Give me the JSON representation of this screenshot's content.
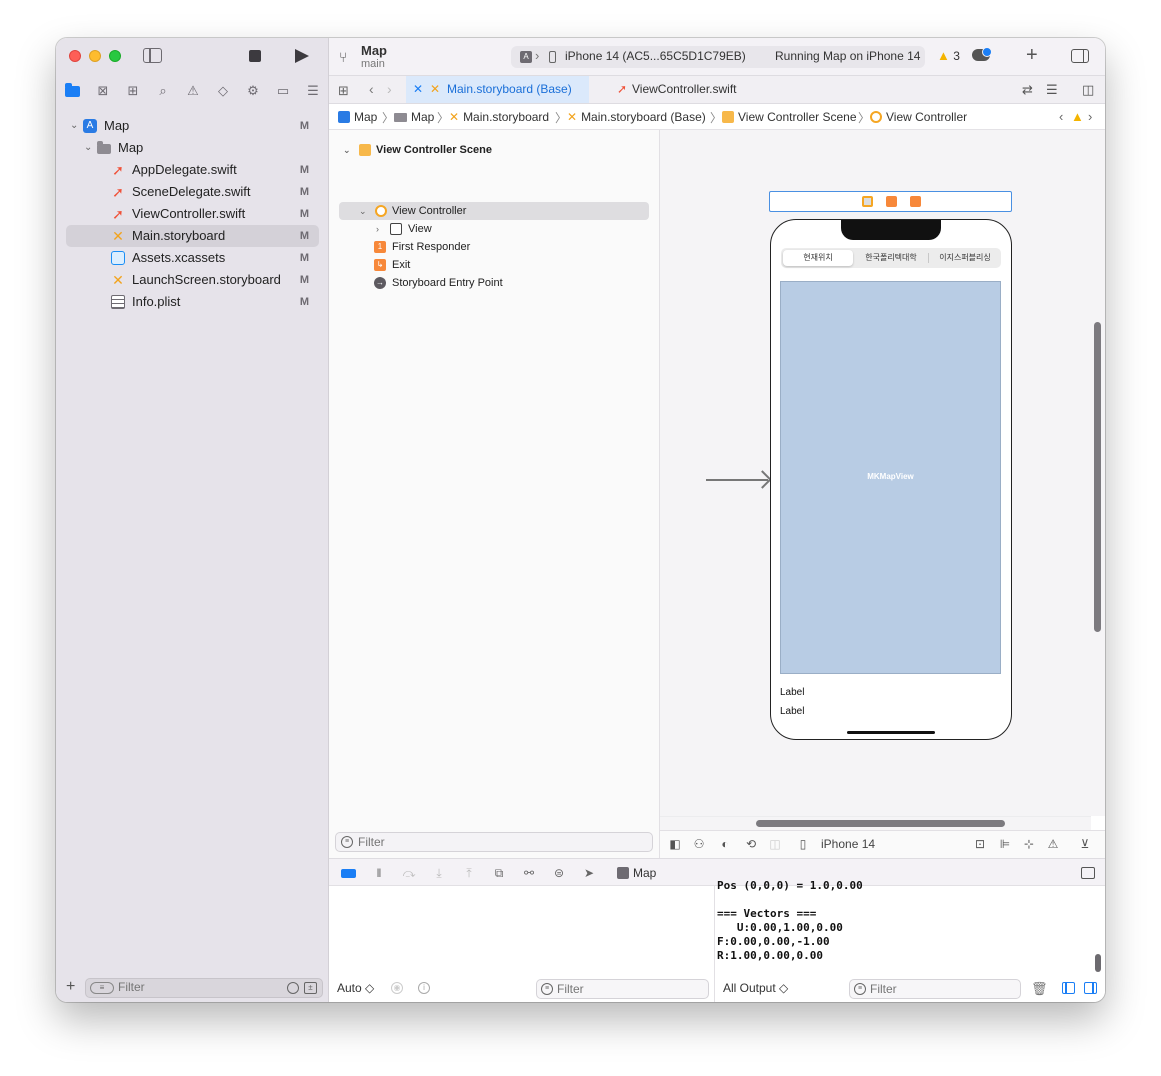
{
  "toolbar": {
    "project_name": "Map",
    "branch": "main",
    "activity_device": "iPhone 14 (AC5...65C5D1C79EB)",
    "activity_status": "Running Map on iPhone 14",
    "warning_count": "3"
  },
  "editor_tabs": [
    {
      "label": "Main.storyboard (Base)",
      "active": true
    },
    {
      "label": "ViewController.swift",
      "active": false
    }
  ],
  "breadcrumb": [
    "Map",
    "Map",
    "Main.storyboard",
    "Main.storyboard (Base)",
    "View Controller Scene",
    "View Controller"
  ],
  "navigator": {
    "items": [
      {
        "label": "Map",
        "mark": "M"
      },
      {
        "label": "Map",
        "mark": ""
      },
      {
        "label": "AppDelegate.swift",
        "mark": "M"
      },
      {
        "label": "SceneDelegate.swift",
        "mark": "M"
      },
      {
        "label": "ViewController.swift",
        "mark": "M"
      },
      {
        "label": "Main.storyboard",
        "mark": "M"
      },
      {
        "label": "Assets.xcassets",
        "mark": "M"
      },
      {
        "label": "LaunchScreen.storyboard",
        "mark": "M"
      },
      {
        "label": "Info.plist",
        "mark": "M"
      }
    ],
    "filter_placeholder": "Filter"
  },
  "outline": {
    "items": [
      {
        "label": "View Controller Scene"
      },
      {
        "label": "View Controller"
      },
      {
        "label": "View"
      },
      {
        "label": "First Responder"
      },
      {
        "label": "Exit"
      },
      {
        "label": "Storyboard Entry Point"
      }
    ],
    "filter_placeholder": "Filter"
  },
  "canvas": {
    "segments": [
      "현재위치",
      "한국폴리텍대학",
      "이지스퍼블리싱"
    ],
    "mapview_label": "MKMapView",
    "label1": "Label",
    "label2": "Label",
    "device": "iPhone 14"
  },
  "debug": {
    "process": "Map"
  },
  "variables": {
    "scope": "Auto ◇",
    "filter_placeholder": "Filter"
  },
  "console": {
    "output": "Pos (0,0,0) = 1.0,0.00\n\n=== Vectors ===\n   U:0.00,1.00,0.00\nF:0.00,0.00,-1.00\nR:1.00,0.00,0.00",
    "output_selector": "All Output ◇",
    "filter_placeholder": "Filter"
  },
  "colors": {
    "accent": "#1a7ef5",
    "swift": "#f05138",
    "storyboard": "#f2a31c",
    "mapview": "#b8cce4"
  }
}
